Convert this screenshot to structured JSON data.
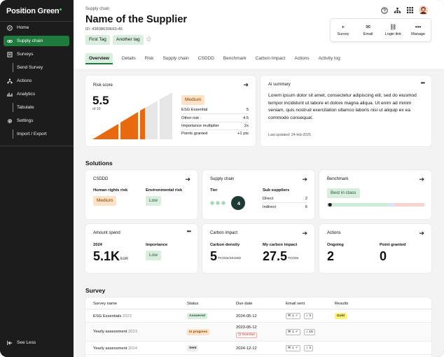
{
  "brand": {
    "name": "Position Green",
    "accent": "#1f7a3e",
    "dot": "#3fd07a"
  },
  "sidebar": {
    "items": [
      {
        "label": "Home",
        "icon": "compass-icon"
      },
      {
        "label": "Supply chain",
        "icon": "link-icon",
        "active": true
      },
      {
        "label": "Surveys",
        "icon": "survey-icon"
      },
      {
        "label": "Send Survey",
        "sub": true
      },
      {
        "label": "Actions",
        "icon": "network-icon"
      },
      {
        "label": "Analytics",
        "icon": "analytics-icon"
      },
      {
        "label": "Tabulate",
        "sub": true
      },
      {
        "label": "Settings",
        "icon": "gear-icon"
      },
      {
        "label": "Import / Export",
        "sub": true
      }
    ],
    "see_less": "See Less"
  },
  "header": {
    "breadcrumb": "Supply chain",
    "title": "Name of the Supplier",
    "id_text": "ID: 43838630693-46",
    "tags": [
      "First Tag",
      "Another tag"
    ],
    "top_icons": [
      "help-icon",
      "org-icon",
      "apps-icon",
      "avatar"
    ],
    "actions": [
      {
        "label": "Survey",
        "glyph": "+"
      },
      {
        "label": "Email",
        "glyph": "✉"
      },
      {
        "label": "Login link",
        "glyph": "⛓"
      },
      {
        "label": "Manage",
        "glyph": "•••"
      }
    ],
    "tabs": [
      "Overview",
      "Details",
      "Risk",
      "Supply chain",
      "CSDDD",
      "Benchmark",
      "Carbon Impact",
      "Actions",
      "Activity log"
    ],
    "active_tab": "Overview"
  },
  "risk": {
    "title": "Risk score",
    "score": "5.5",
    "of": "of 10",
    "level": "Medium",
    "gauge_fill": 0.55,
    "rows": [
      {
        "label": "ESG Essential",
        "value": "5"
      },
      {
        "label": "Other risk",
        "value": "4.5"
      },
      {
        "label": "Importance multiplier",
        "value": "2x"
      },
      {
        "label": "Points granted",
        "value": "+1 pts"
      }
    ]
  },
  "ai": {
    "title": "Ai summary",
    "text": "Lorem ipsum dolor sit amet, consectetur adipiscing elit, sed do eiusmod tempor incididunt ut labore et dolore magna aliqua. Ut enim ad minim veniam, quis nostrud exercitation ullamco laboris nisi ut aliquip ex ea commodo consequat.",
    "updated": "Last updated: 24-feb-2025"
  },
  "solutions": {
    "heading": "Solutions",
    "csddd": {
      "title": "CSDDD",
      "hr_label": "Human rights risk",
      "hr_value": "Medium",
      "env_label": "Environmental risk",
      "env_value": "Low"
    },
    "supply": {
      "title": "Supply chain",
      "tier_label": "Tier",
      "tier": "4",
      "sub_label": "Sub suppliers",
      "direct_label": "Direct",
      "direct": "2",
      "indirect_label": "Indirect",
      "indirect": "6"
    },
    "bench": {
      "title": "Benchmark",
      "label": "Best in class",
      "position": 0.03
    },
    "spend": {
      "title": "Amount spend",
      "year": "2024",
      "value": "5.1K",
      "unit": "EUR",
      "imp_label": "Importance",
      "imp_value": "Low"
    },
    "carbon": {
      "title": "Carbon impact",
      "density_label": "Carbon density",
      "density": "5",
      "density_unit": "TCO2e/1KUSD",
      "my_label": "My carbon impact",
      "my": "27.5",
      "my_unit": "TCO2e"
    },
    "actions": {
      "title": "Actions",
      "ongoing_label": "Ongoing",
      "ongoing": "2",
      "granted_label": "Point granted",
      "granted": "0"
    }
  },
  "survey": {
    "heading": "Survey",
    "columns": [
      "Survey name",
      "Status",
      "Due date",
      "Email sent",
      "Results"
    ],
    "rows": [
      {
        "name": "ESG Essentials",
        "year": "2023",
        "status": "Answered",
        "status_kind": "ans",
        "due": "2024-05-12",
        "overdue": "",
        "mail": "1",
        "bell": "3",
        "result": "Gold"
      },
      {
        "name": "Yearly assessment",
        "year": "2023",
        "status": "In progress",
        "status_kind": "prog",
        "due": "2023-05-12",
        "overdue": "Overdue",
        "mail": "1",
        "bell": "15",
        "result": ""
      },
      {
        "name": "Yearly assessment",
        "year": "2024",
        "status": "Sent",
        "status_kind": "sent",
        "due": "2024-12-12",
        "overdue": "",
        "mail": "1",
        "bell": "3",
        "result": ""
      }
    ]
  }
}
